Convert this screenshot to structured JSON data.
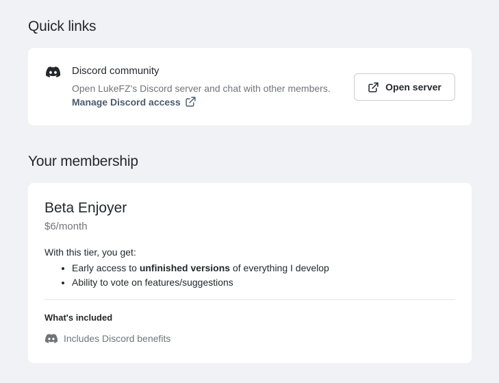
{
  "quick_links": {
    "title": "Quick links",
    "discord": {
      "icon": "discord-icon",
      "title": "Discord community",
      "description": "Open LukeFZ's Discord server and chat with other members.",
      "manage_label": "Manage Discord access",
      "manage_icon": "external-link-icon",
      "button_label": "Open server",
      "button_icon": "external-link-icon"
    }
  },
  "membership": {
    "title": "Your membership",
    "tier_name": "Beta Enjoyer",
    "price": "$6/month",
    "intro": "With this tier, you get:",
    "benefits": [
      {
        "before": "Early access to ",
        "bold": "unfinished versions",
        "after": " of everything I develop"
      },
      {
        "before": "Ability to vote on features/suggestions",
        "bold": "",
        "after": ""
      }
    ],
    "included_title": "What's included",
    "included_items": [
      {
        "icon": "discord-icon",
        "label": "Includes Discord benefits"
      }
    ]
  },
  "colors": {
    "background": "#f0f2f5",
    "card": "#ffffff",
    "text": "#24272b",
    "muted": "#707479",
    "link": "#4a5a6d"
  }
}
